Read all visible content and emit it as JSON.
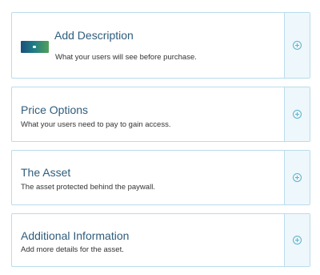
{
  "sections": [
    {
      "title": "Add Description",
      "description": "What your users will see before purchase.",
      "action_icon": "plus-circle-icon",
      "thumbnail": "image-thumbnail"
    },
    {
      "title": "Price Options",
      "description": "What your users need to pay to gain access.",
      "action_icon": "plus-circle-icon"
    },
    {
      "title": "The Asset",
      "description": "The asset protected behind the paywall.",
      "action_icon": "plus-circle-icon"
    },
    {
      "title": "Additional Information",
      "description": "Add more details for the asset.",
      "action_icon": "plus-circle-icon"
    }
  ],
  "colors": {
    "border": "#b9dcea",
    "side_panel": "#eef7fb",
    "icon": "#5cb3cc",
    "title": "#2f5d7c",
    "description": "#333333"
  }
}
